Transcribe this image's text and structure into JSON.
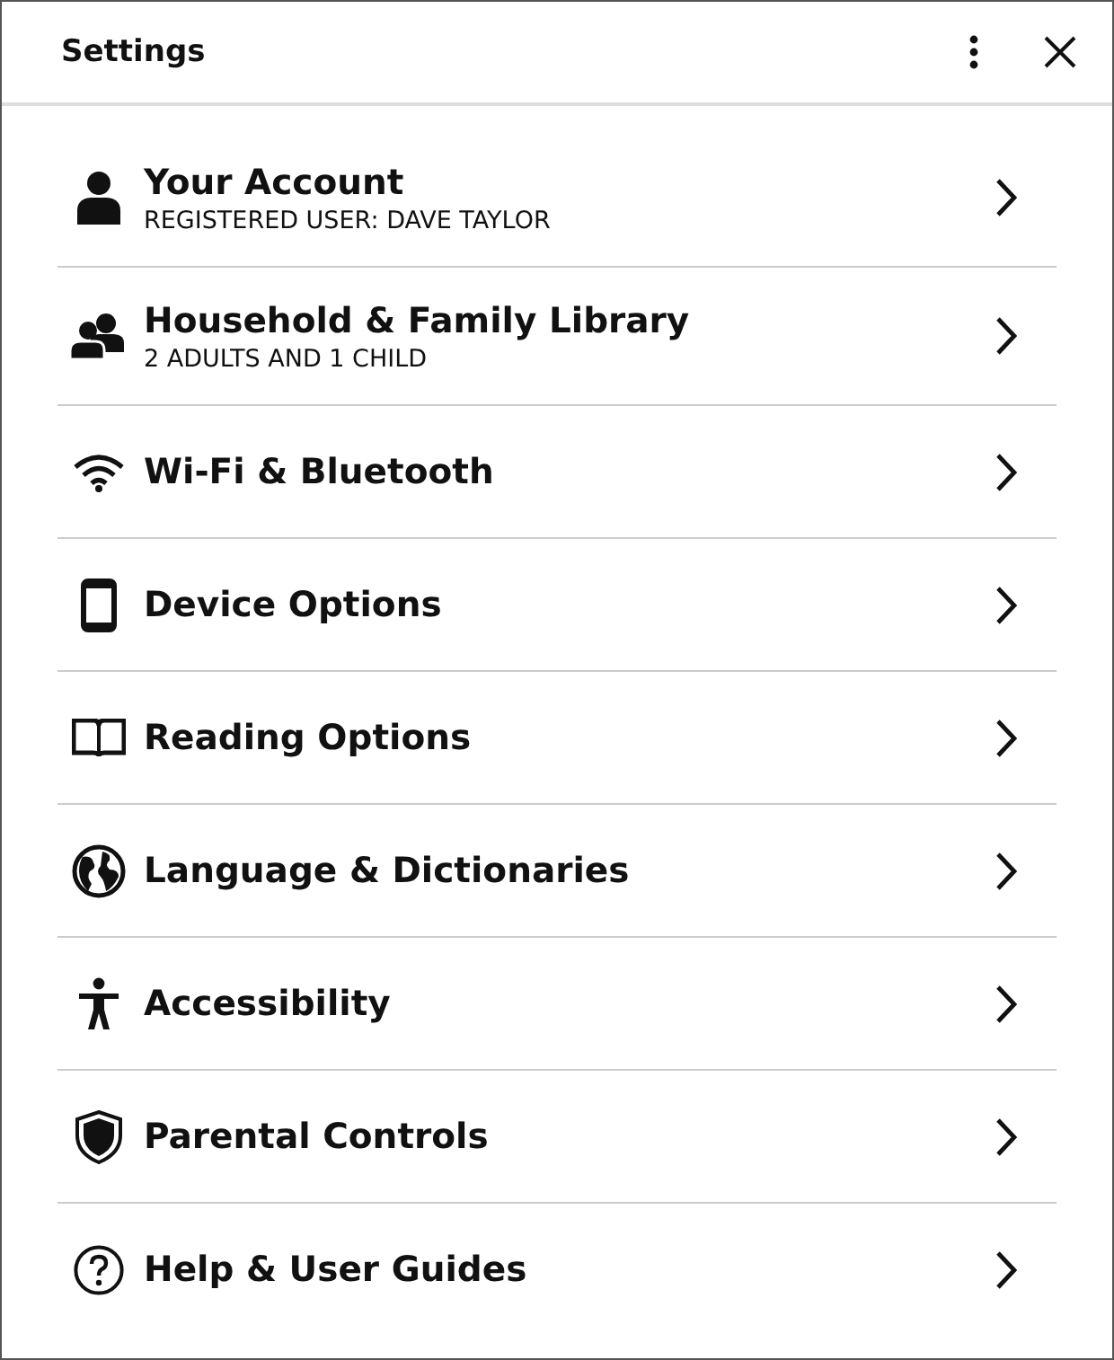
{
  "window": {
    "title": "Settings"
  },
  "items": [
    {
      "title": "Your Account",
      "subtitle": "REGISTERED USER: DAVE TAYLOR"
    },
    {
      "title": "Household & Family Library",
      "subtitle": "2 ADULTS AND 1 CHILD"
    },
    {
      "title": "Wi-Fi & Bluetooth"
    },
    {
      "title": "Device Options"
    },
    {
      "title": "Reading Options"
    },
    {
      "title": "Language & Dictionaries"
    },
    {
      "title": "Accessibility"
    },
    {
      "title": "Parental Controls"
    },
    {
      "title": "Help & User Guides"
    }
  ]
}
